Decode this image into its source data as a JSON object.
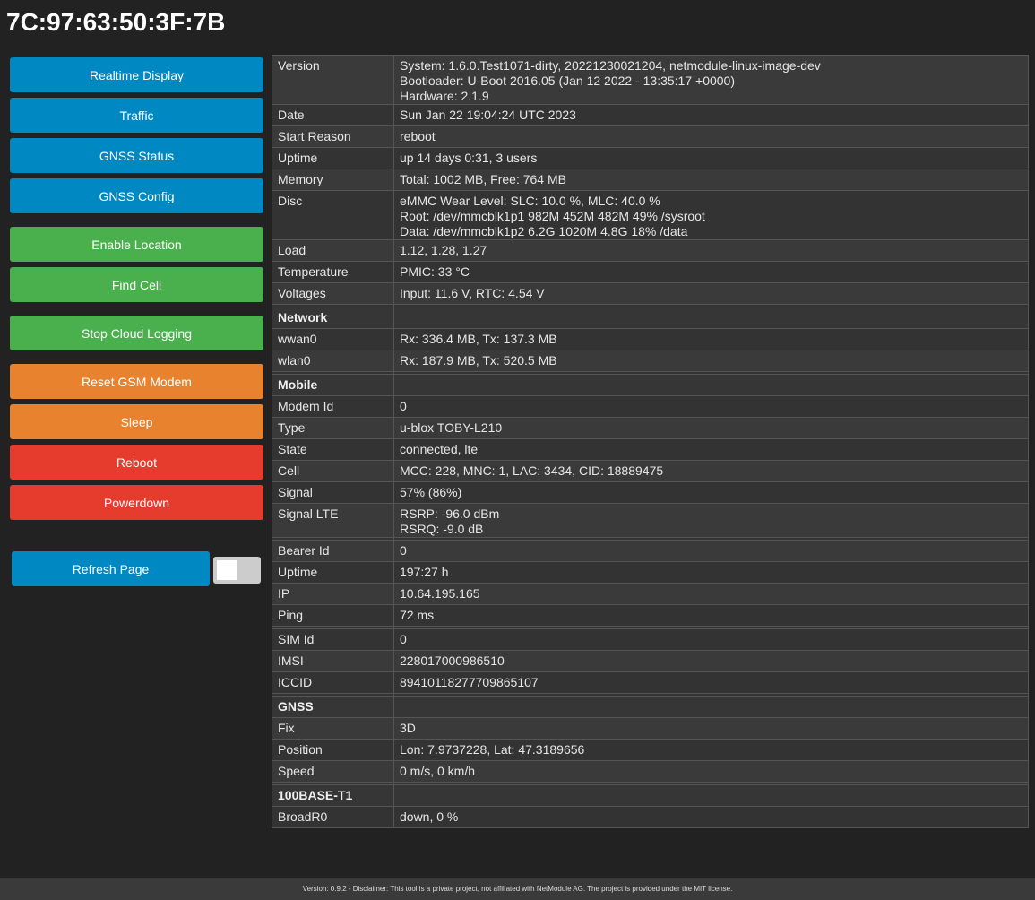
{
  "device_id": "7C:97:63:50:3F:7B",
  "sidebar": {
    "buttons": [
      {
        "label": "Realtime Display"
      },
      {
        "label": "Traffic"
      },
      {
        "label": "GNSS Status"
      },
      {
        "label": "GNSS Config"
      },
      {
        "label": "Enable Location"
      },
      {
        "label": "Find Cell"
      },
      {
        "label": "Stop Cloud Logging"
      },
      {
        "label": "Reset GSM Modem"
      },
      {
        "label": "Sleep"
      },
      {
        "label": "Reboot"
      },
      {
        "label": "Powerdown"
      }
    ],
    "refresh_label": "Refresh Page",
    "auto_refresh_enabled": false
  },
  "colors": {
    "blue": "#0088c2",
    "green": "#49b04d",
    "orange": "#e9822e",
    "red": "#e63c2e",
    "background": "#222222"
  },
  "table": {
    "version": {
      "label": "Version",
      "lines": [
        "System: 1.6.0.Test1071-dirty, 20221230021204, netmodule-linux-image-dev",
        "Bootloader: U-Boot 2016.05 (Jan 12 2022 - 13:35:17 +0000)",
        "Hardware: 2.1.9"
      ]
    },
    "date": {
      "label": "Date",
      "value": "Sun Jan 22 19:04:24 UTC 2023"
    },
    "start_reason": {
      "label": "Start Reason",
      "value": "reboot"
    },
    "uptime": {
      "label": "Uptime",
      "value": "up 14 days 0:31, 3 users"
    },
    "memory": {
      "label": "Memory",
      "value": "Total: 1002 MB, Free: 764 MB"
    },
    "disc": {
      "label": "Disc",
      "lines": [
        "eMMC Wear Level: SLC: 10.0 %, MLC: 40.0 %",
        "Root: /dev/mmcblk1p1 982M 452M 482M 49% /sysroot",
        "Data: /dev/mmcblk1p2 6.2G 1020M 4.8G 18% /data"
      ]
    },
    "load": {
      "label": "Load",
      "value": "1.12, 1.28, 1.27"
    },
    "temperature": {
      "label": "Temperature",
      "value": "PMIC: 33 °C"
    },
    "voltages": {
      "label": "Voltages",
      "value": "Input: 11.6 V, RTC: 4.54 V"
    },
    "network": {
      "heading": "Network",
      "wwan0": {
        "label": "wwan0",
        "value": "Rx: 336.4 MB, Tx: 137.3 MB"
      },
      "wlan0": {
        "label": "wlan0",
        "value": "Rx: 187.9 MB, Tx: 520.5 MB"
      }
    },
    "mobile": {
      "heading": "Mobile",
      "modem_id": {
        "label": "Modem Id",
        "value": "0"
      },
      "type": {
        "label": "Type",
        "value": "u-blox TOBY-L210"
      },
      "state": {
        "label": "State",
        "value": "connected, lte"
      },
      "cell": {
        "label": "Cell",
        "value": "MCC: 228, MNC: 1, LAC: 3434, CID: 18889475"
      },
      "signal": {
        "label": "Signal",
        "value": "57% (86%)"
      },
      "signal_lte": {
        "label": "Signal LTE",
        "lines": [
          "RSRP: -96.0 dBm",
          "RSRQ: -9.0 dB"
        ]
      },
      "bearer_id": {
        "label": "Bearer Id",
        "value": "0"
      },
      "uptime": {
        "label": "Uptime",
        "value": "197:27 h"
      },
      "ip": {
        "label": "IP",
        "value": "10.64.195.165"
      },
      "ping": {
        "label": "Ping",
        "value": "72 ms"
      },
      "sim_id": {
        "label": "SIM Id",
        "value": "0"
      },
      "imsi": {
        "label": "IMSI",
        "value": "228017000986510"
      },
      "iccid": {
        "label": "ICCID",
        "value": "89410118277709865107"
      }
    },
    "gnss": {
      "heading": "GNSS",
      "fix": {
        "label": "Fix",
        "value": "3D"
      },
      "position": {
        "label": "Position",
        "value": "Lon: 7.9737228, Lat: 47.3189656"
      },
      "speed": {
        "label": "Speed",
        "value": "0 m/s, 0 km/h"
      }
    },
    "ethernet": {
      "heading": "100BASE-T1",
      "broadr0": {
        "label": "BroadR0",
        "value": "down, 0 %"
      }
    }
  },
  "footer": {
    "text": "Version: 0.9.2 - Disclaimer: This tool is a private project, not affiliated with NetModule AG. The project is provided under the MIT license."
  }
}
